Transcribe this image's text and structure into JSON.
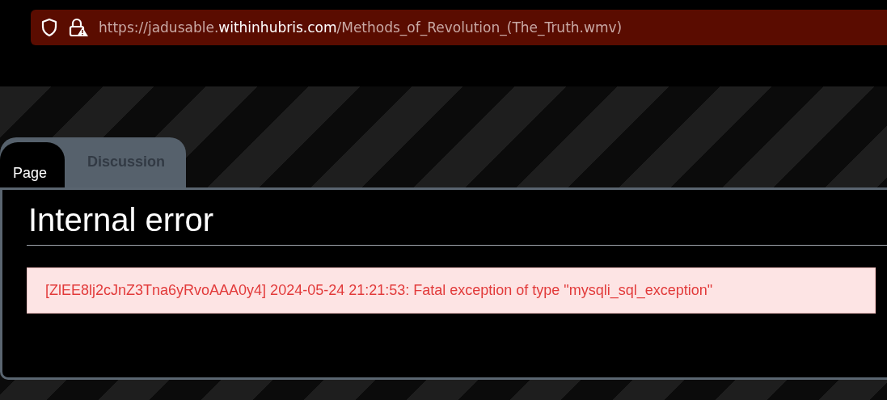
{
  "address_bar": {
    "url_prefix": "https://jadusable.",
    "url_domain": "withinhubris.com",
    "url_path": "/Methods_of_Revolution_(The_Truth.wmv)"
  },
  "tabs": [
    {
      "label": "Page",
      "selected": true
    },
    {
      "label": "Discussion",
      "selected": false
    }
  ],
  "heading": "Internal error",
  "error_message": "[ZlEE8lj2cJnZ3Tna6yRvoAAA0y4] 2024-05-24 21:21:53: Fatal exception of type \"mysqli_sql_exception\""
}
